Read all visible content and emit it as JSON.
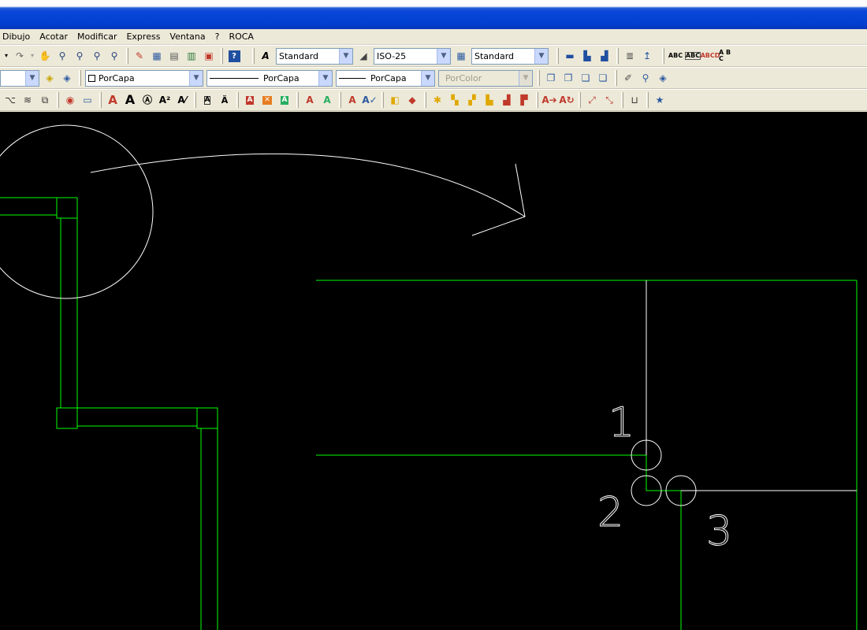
{
  "window": {
    "title": ""
  },
  "menu": [
    "Dibujo",
    "Acotar",
    "Modificar",
    "Express",
    "Ventana",
    "?",
    "ROCA"
  ],
  "toolbar": {
    "text_style": "Standard",
    "dim_style": "ISO-25",
    "table_style": "Standard",
    "layer": "PorCapa",
    "linetype": "PorCapa",
    "lineweight": "PorCapa",
    "plotstyle": "PorColor"
  },
  "colors": {
    "titlebar": "#0a47d8",
    "canvas": "#000000",
    "geometry_green": "#00ff00",
    "annotation_white": "#ffffff"
  },
  "drawing": {
    "point_labels": [
      "1",
      "2",
      "3"
    ]
  },
  "icons": {
    "row1": [
      "redo-icon",
      "pan-icon",
      "zoom-realtime-icon",
      "zoom-window-icon",
      "zoom-previous-icon",
      "zoom-extents-icon",
      "properties-icon",
      "design-center-icon",
      "tool-palettes-icon",
      "sheet-set-icon",
      "markup-icon",
      "calc-icon",
      "help-icon"
    ],
    "row2_right": [
      "send-to-back-icon",
      "bring-to-front-icon",
      "draworder-above-icon",
      "draworder-below-icon",
      "match-prop-icon",
      "layer-prev-icon",
      "layer-walk-icon"
    ],
    "row3": [
      "text-icon",
      "bold-text-icon",
      "arc-text-icon",
      "super-text-icon",
      "scale-text-icon",
      "find-text-icon",
      "spell-icon"
    ]
  }
}
